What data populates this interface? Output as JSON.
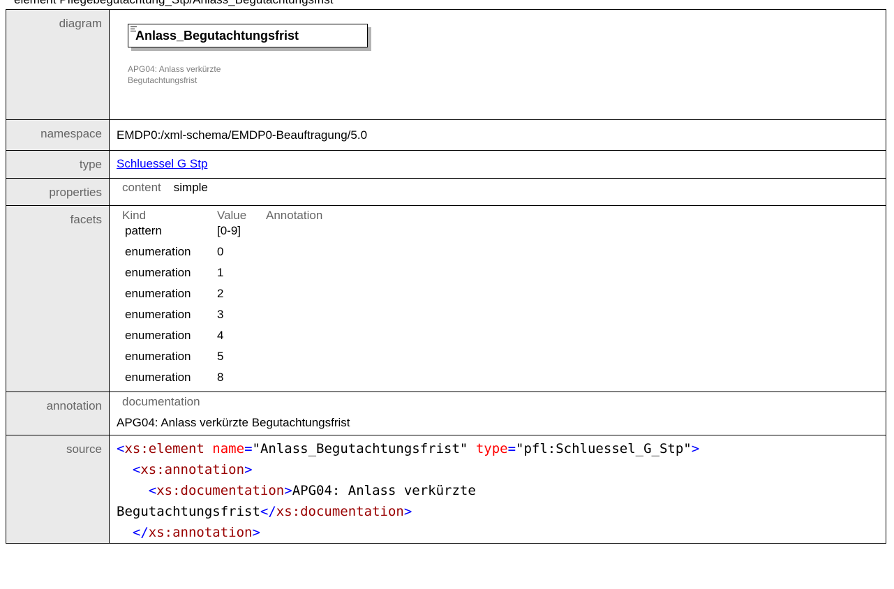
{
  "page": {
    "heading": "element Pflegebegutachtung_Stp/Anlass_Begutachtungsfrist"
  },
  "diagram": {
    "label": "diagram",
    "element_name": "Anlass_Begutachtungsfrist",
    "annotation_line1": "APG04: Anlass verkürzte",
    "annotation_line2": "Begutachtungsfrist"
  },
  "namespace": {
    "label": "namespace",
    "value": "EMDP0:/xml-schema/EMDP0-Beauftragung/5.0"
  },
  "type": {
    "label": "type",
    "link_text": "Schluessel G Stp"
  },
  "properties": {
    "label": "properties",
    "key": "content",
    "value": "simple"
  },
  "facets": {
    "label": "facets",
    "headers": [
      "Kind",
      "Value",
      "Annotation"
    ],
    "rows": [
      {
        "kind": "pattern",
        "value": "[0-9]"
      },
      {
        "kind": "enumeration",
        "value": "0"
      },
      {
        "kind": "enumeration",
        "value": "1"
      },
      {
        "kind": "enumeration",
        "value": "2"
      },
      {
        "kind": "enumeration",
        "value": "3"
      },
      {
        "kind": "enumeration",
        "value": "4"
      },
      {
        "kind": "enumeration",
        "value": "5"
      },
      {
        "kind": "enumeration",
        "value": "8"
      }
    ]
  },
  "annotation": {
    "label": "annotation",
    "key": "documentation",
    "text": "APG04: Anlass verkürzte Begutachtungsfrist"
  },
  "source": {
    "label": "source",
    "tag_element": "xs:element",
    "attr_name": "name",
    "name_value": "\"Anlass_Begutachtungsfrist\"",
    "attr_type": "type",
    "type_value": "\"pfl:Schluessel_G_Stp\"",
    "tag_annotation": "xs:annotation",
    "tag_documentation": "xs:documentation",
    "doc_text_1": "APG04: Anlass verkürzte",
    "doc_text_2": "Begutachtungsfrist"
  },
  "colors": {
    "label_bg": "#eaeaea",
    "link": "#0000ff",
    "code_tag": "#990000",
    "code_attr": "#ff0000"
  }
}
